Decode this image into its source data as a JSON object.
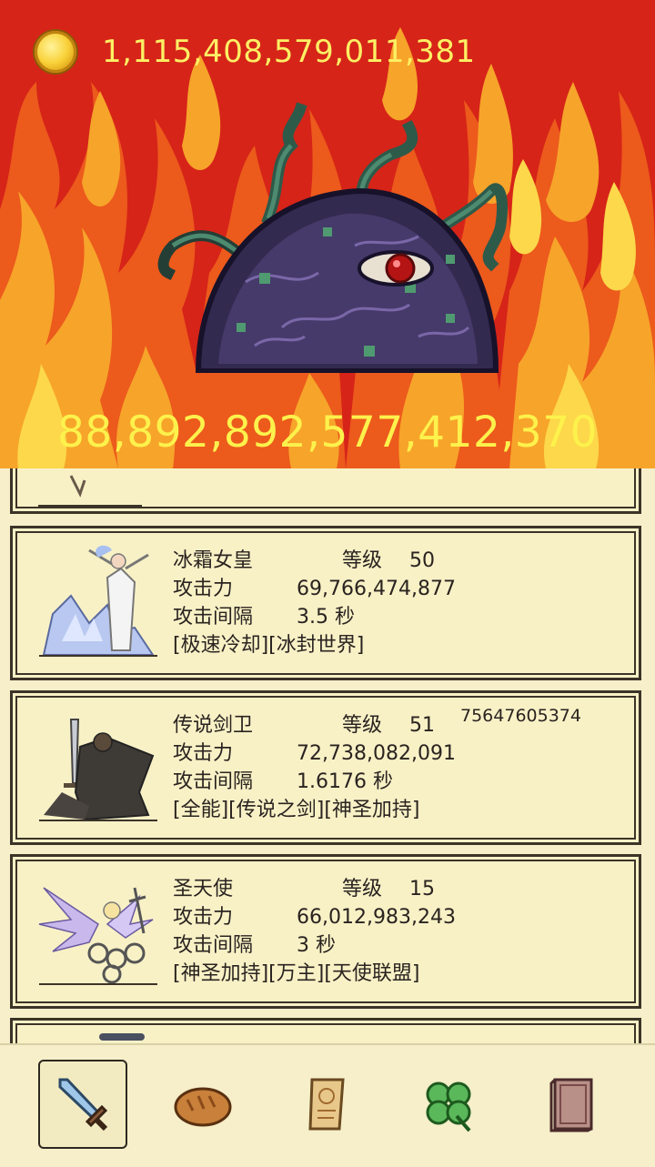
{
  "header": {
    "coin_amount": "1,115,408,579,011,381",
    "boss_hp": "88,892,892,577,412,370"
  },
  "labels": {
    "level": "等级",
    "attack": "攻击力",
    "interval": "攻击间隔",
    "seconds": "秒"
  },
  "heroes": [
    {
      "name": "冰霜女皇",
      "level": "50",
      "attack": "69,766,474,877",
      "interval": "3.5",
      "tags": "[极速冷却][冰封世界]",
      "badge": ""
    },
    {
      "name": "传说剑卫",
      "level": "51",
      "attack": "72,738,082,091",
      "interval": "1.6176",
      "tags": "[全能][传说之剑][神圣加持]",
      "badge": "75647605374"
    },
    {
      "name": "圣天使",
      "level": "15",
      "attack": "66,012,983,243",
      "interval": "3",
      "tags": "[神圣加持][万主][天使联盟]",
      "badge": ""
    }
  ],
  "nav": {
    "items": [
      "sword-icon",
      "bread-icon",
      "scroll-icon",
      "clover-icon",
      "book-icon"
    ],
    "active": "sword-icon"
  },
  "colors": {
    "battle_bg": "#d9261a",
    "number_yellow": "#fdf24c",
    "card_bg": "#f8f1c6",
    "card_border": "#3c3428"
  }
}
